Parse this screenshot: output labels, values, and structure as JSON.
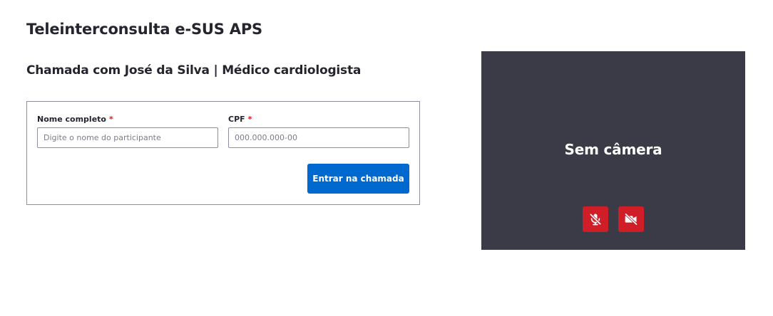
{
  "header": {
    "app_title": "Teleinterconsulta e-SUS APS",
    "call_title": "Chamada com José da Silva | Médico cardiologista"
  },
  "form": {
    "name_field": {
      "label": "Nome completo",
      "required_mark": "*",
      "placeholder": "Digite o nome do participante",
      "value": ""
    },
    "cpf_field": {
      "label": "CPF",
      "required_mark": "*",
      "placeholder": "000.000.000-00",
      "value": ""
    },
    "join_label": "Entrar na chamada"
  },
  "video": {
    "status_text": "Sem câmera",
    "mic_icon": "mic-off-icon",
    "camera_icon": "camera-off-icon",
    "controls_color": "#d01e29",
    "background_color": "#3b3b47"
  },
  "colors": {
    "primary": "#0069d0",
    "danger": "#d01e29",
    "text": "#24252e"
  }
}
